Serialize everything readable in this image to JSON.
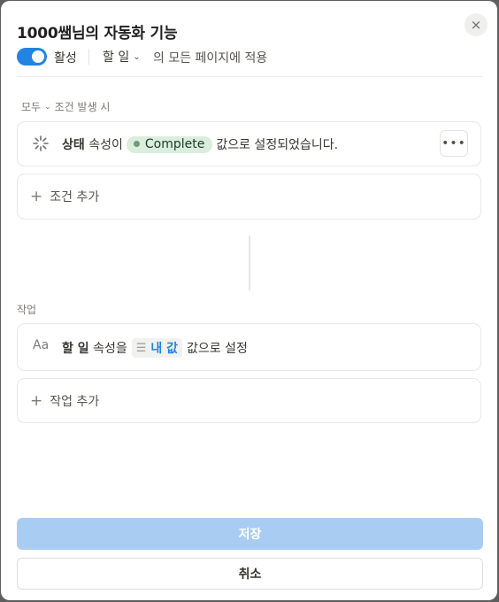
{
  "dialog": {
    "title": "1000쌤님의 자동화 기능",
    "close_icon": "×"
  },
  "status_row": {
    "toggle_on": true,
    "active_label": "활성",
    "scope_property": "할 일",
    "scope_text": "의 모든 페이지에 적용"
  },
  "trigger_section": {
    "mode": "모두",
    "header": "조건 발생 시",
    "trigger": {
      "property": "상태",
      "text_before": "속성이",
      "value": "Complete",
      "text_after": "값으로 설정되었습니다.",
      "more_label": "•••"
    },
    "add_label": "조건 추가"
  },
  "action_section": {
    "header": "작업",
    "action": {
      "type_icon": "Aa",
      "property": "할 일",
      "text_before": "속성을",
      "value": "내 값",
      "text_after": "값으로 설정"
    },
    "add_label": "작업 추가"
  },
  "footer": {
    "save_label": "저장",
    "cancel_label": "취소"
  },
  "colors": {
    "accent": "#2383e2",
    "save_disabled": "#a9cdf2",
    "pill_bg": "#dbeddb",
    "pill_dot": "#6c9b7d"
  }
}
